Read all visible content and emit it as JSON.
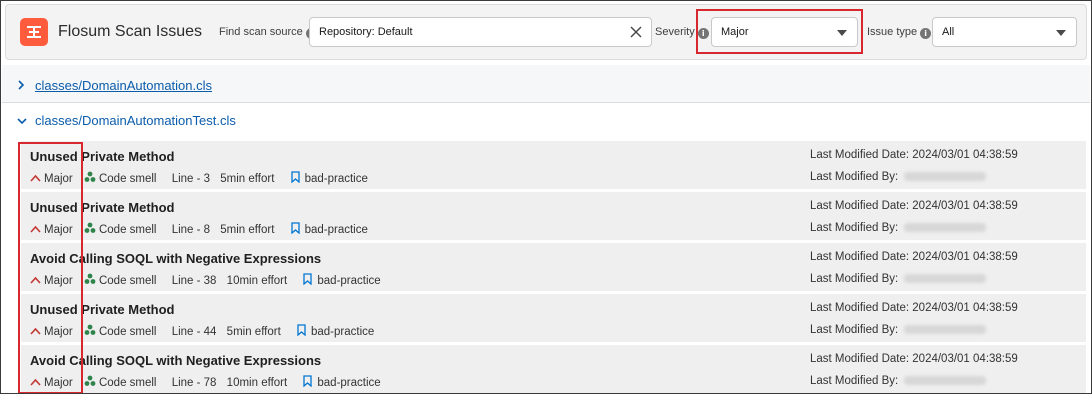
{
  "header": {
    "app_title": "Flosum Scan Issues",
    "find_source_label": "Find scan source",
    "find_source_value": "Repository: Default",
    "severity_label": "Severity",
    "severity_value": "Major",
    "issue_type_label": "Issue type",
    "issue_type_value": "All"
  },
  "files": [
    {
      "name": "classes/DomainAutomation.cls",
      "expanded": false
    },
    {
      "name": "classes/DomainAutomationTest.cls",
      "expanded": true
    }
  ],
  "issues": [
    {
      "title": "Unused Private Method",
      "severity": "Major",
      "type": "Code smell",
      "line": "Line - 3",
      "effort": "5min effort",
      "tag": "bad-practice",
      "modified_date": "Last Modified Date: 2024/03/01 04:38:59",
      "modified_by": "Last Modified By:"
    },
    {
      "title": "Unused Private Method",
      "severity": "Major",
      "type": "Code smell",
      "line": "Line - 8",
      "effort": "5min effort",
      "tag": "bad-practice",
      "modified_date": "Last Modified Date: 2024/03/01 04:38:59",
      "modified_by": "Last Modified By:"
    },
    {
      "title": "Avoid Calling SOQL with Negative Expressions",
      "severity": "Major",
      "type": "Code smell",
      "line": "Line - 38",
      "effort": "10min effort",
      "tag": "bad-practice",
      "modified_date": "Last Modified Date: 2024/03/01 04:38:59",
      "modified_by": "Last Modified By:"
    },
    {
      "title": "Unused Private Method",
      "severity": "Major",
      "type": "Code smell",
      "line": "Line - 44",
      "effort": "5min effort",
      "tag": "bad-practice",
      "modified_date": "Last Modified Date: 2024/03/01 04:38:59",
      "modified_by": "Last Modified By:"
    },
    {
      "title": "Avoid Calling SOQL with Negative Expressions",
      "severity": "Major",
      "type": "Code smell",
      "line": "Line - 78",
      "effort": "10min effort",
      "tag": "bad-practice",
      "modified_date": "Last Modified Date: 2024/03/01 04:38:59",
      "modified_by": "Last Modified By:"
    }
  ],
  "icons": {
    "app": "flosum-logo-icon",
    "info": "info-icon",
    "clear": "close-icon",
    "dropdown": "chevron-down-icon",
    "collapsed": "chevron-right-icon",
    "expanded": "chevron-down-icon",
    "severity": "arrow-up-icon",
    "code_smell": "code-smell-icon",
    "tag": "bookmark-icon"
  },
  "colors": {
    "brand": "#fe5c3c",
    "link": "#0b5cab",
    "severity_major": "#c23934",
    "code_smell": "#2e844a",
    "tag": "#0176d3",
    "highlight": "#d6282e"
  }
}
